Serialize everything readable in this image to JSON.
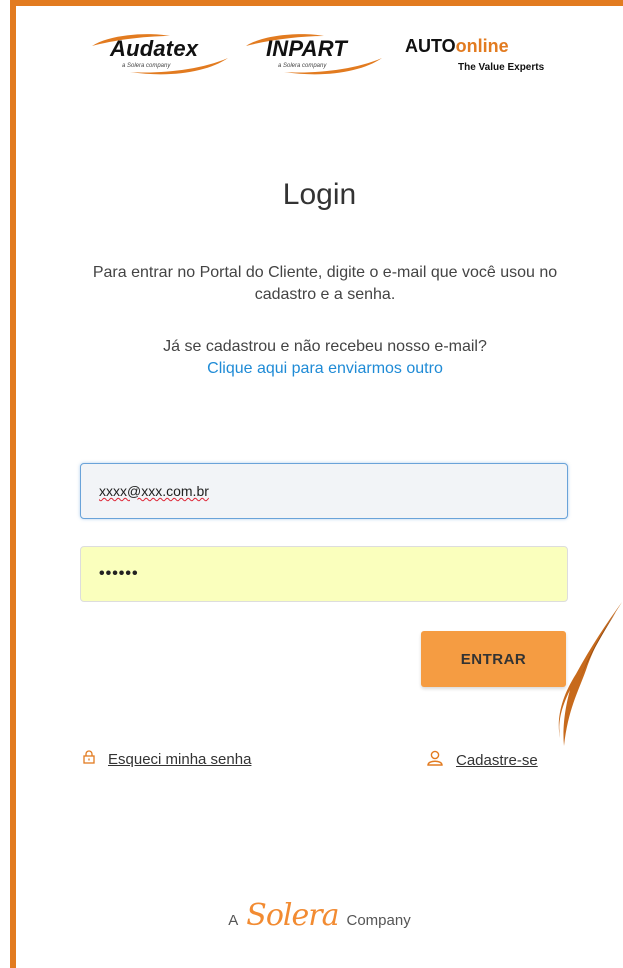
{
  "logos": {
    "audatex": {
      "name": "Audatex",
      "sub": "a Solera company"
    },
    "inpart": {
      "name": "INPART",
      "sub": "a Solera company"
    },
    "autoonline": {
      "name_a": "AUTO",
      "name_b": "online",
      "tagline": "The Value Experts"
    }
  },
  "login": {
    "title": "Login",
    "description": "Para entrar no Portal do Cliente, digite o e-mail que você usou no cadastro e a senha.",
    "question": "Já se cadastrou e não recebeu nosso e-mail?",
    "resend_link": "Clique aqui para enviarmos outro",
    "email_value": "xxxx@xxx.com.br",
    "password_value": "••••••",
    "submit_label": "ENTRAR"
  },
  "links": {
    "forgot_password": "Esqueci minha senha",
    "signup": "Cadastre-se"
  },
  "footer": {
    "prefix": "A",
    "brand": "Solera",
    "suffix": "Company"
  },
  "colors": {
    "accent": "#e27b20",
    "button": "#f59c42",
    "link": "#1f8bd6",
    "autofill": "#faffbd"
  },
  "icons": [
    "lock-icon",
    "user-icon",
    "brush-stroke-decoration"
  ]
}
